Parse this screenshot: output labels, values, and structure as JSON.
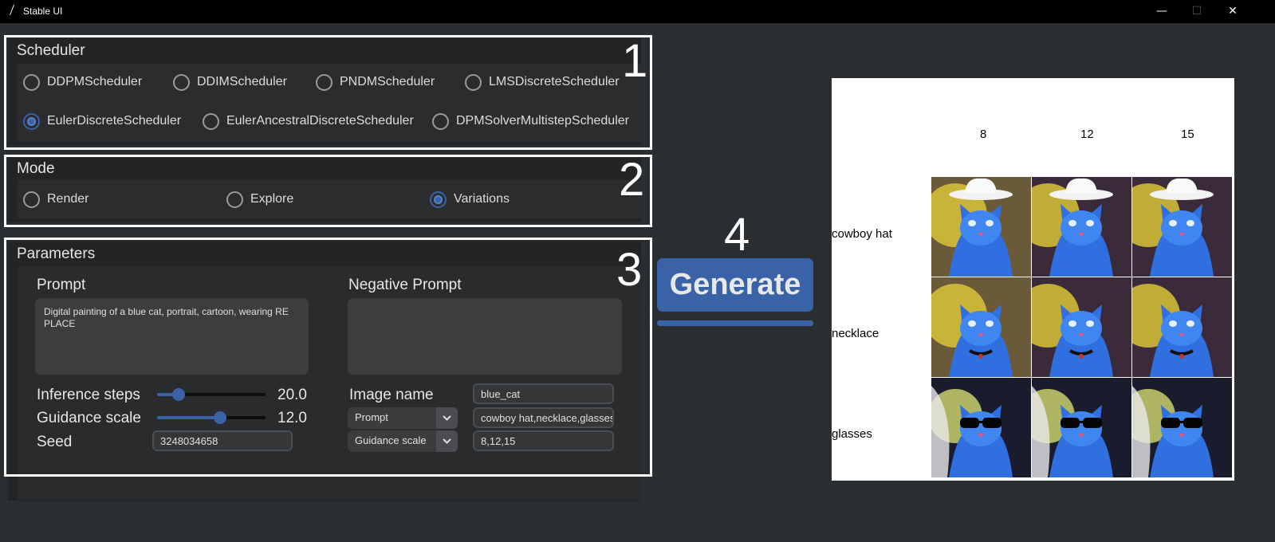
{
  "window": {
    "title": "Stable UI",
    "minimize_glyph": "—",
    "maximize_glyph": "☐",
    "close_glyph": "✕"
  },
  "scheduler": {
    "title": "Scheduler",
    "number": "1",
    "options": [
      "DDPMScheduler",
      "DDIMScheduler",
      "PNDMScheduler",
      "LMSDiscreteScheduler",
      "EulerDiscreteScheduler",
      "EulerAncestralDiscreteScheduler",
      "DPMSolverMultistepScheduler"
    ],
    "selected": "EulerDiscreteScheduler"
  },
  "mode": {
    "title": "Mode",
    "number": "2",
    "options": [
      "Render",
      "Explore",
      "Variations"
    ],
    "selected": "Variations"
  },
  "parameters": {
    "title": "Parameters",
    "number": "3",
    "prompt_label": "Prompt",
    "prompt_value": "Digital painting of a blue cat, portrait, cartoon, wearing RE\nPLACE",
    "negative_prompt_label": "Negative Prompt",
    "negative_prompt_value": "",
    "inference_steps_label": "Inference steps",
    "inference_steps_value": "20.0",
    "inference_steps_fraction": 0.2,
    "guidance_scale_label": "Guidance scale",
    "guidance_scale_value": "12.0",
    "guidance_scale_fraction": 0.58,
    "seed_label": "Seed",
    "seed_value": "3248034658",
    "image_name_label": "Image name",
    "image_name_value": "blue_cat",
    "variation1_select": "Prompt",
    "variation1_values": "cowboy hat,necklace,glasses",
    "variation2_select": "Guidance scale",
    "variation2_values": "8,12,15"
  },
  "generate": {
    "number": "4",
    "label": "Generate"
  },
  "result_grid": {
    "columns": [
      "8",
      "12",
      "15"
    ],
    "rows": [
      "cowboy hat",
      "necklace",
      "glasses"
    ]
  },
  "colors": {
    "accent": "#3a62a6",
    "background": "#2b2e30",
    "panel": "#222425"
  }
}
